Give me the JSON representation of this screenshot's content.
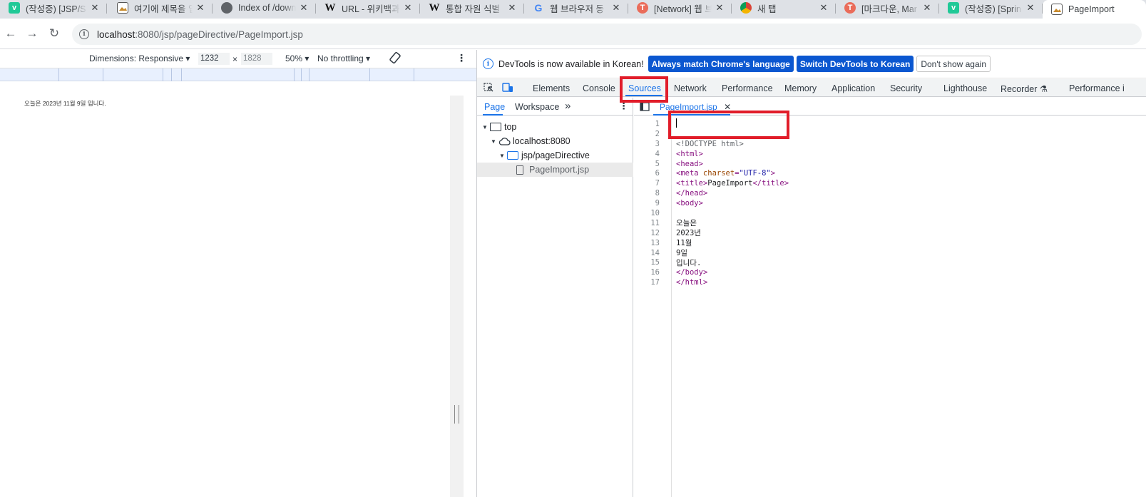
{
  "browser": {
    "tabs": [
      {
        "title": "(작성중) [JSP/S",
        "favicon": "v",
        "favicon_icon": "velog-icon",
        "active": false
      },
      {
        "title": "여기에 제목을 입",
        "favicon": "img",
        "favicon_icon": "image-icon",
        "active": false
      },
      {
        "title": "Index of /down",
        "favicon": "globe",
        "favicon_icon": "globe-icon",
        "active": false
      },
      {
        "title": "URL - 위키백과",
        "favicon": "W",
        "favicon_icon": "wikipedia-icon",
        "active": false
      },
      {
        "title": "통합 자원 식별",
        "favicon": "W",
        "favicon_icon": "wikipedia-icon",
        "active": false
      },
      {
        "title": "웹 브라우저 동",
        "favicon": "G",
        "favicon_icon": "google-icon",
        "active": false
      },
      {
        "title": "[Network] 웹 브",
        "favicon": "T",
        "favicon_icon": "tistory-icon",
        "active": false
      },
      {
        "title": "새 탭",
        "favicon": "chrome",
        "favicon_icon": "chrome-icon",
        "active": false
      },
      {
        "title": "[마크다운, Mar",
        "favicon": "T",
        "favicon_icon": "tistory-icon",
        "active": false
      },
      {
        "title": "(작성중) [Sprin",
        "favicon": "v",
        "favicon_icon": "velog-icon",
        "active": false
      },
      {
        "title": "PageImport",
        "favicon": "img",
        "favicon_icon": "image-icon",
        "active": true
      }
    ],
    "url_host": "localhost",
    "url_path": ":8080/jsp/pageDirective/PageImport.jsp"
  },
  "device_toolbar": {
    "dimensions": "Dimensions: Responsive",
    "width": "1232",
    "height": "1828",
    "times": "×",
    "zoom": "50%",
    "throttling": "No throttling"
  },
  "viewport": {
    "page_text": "오늘은 2023년 11월 9일 입니다."
  },
  "devtools": {
    "infobar": {
      "message": "DevTools is now available in Korean!",
      "btn_match": "Always match Chrome's language",
      "btn_switch": "Switch DevTools to Korean",
      "btn_dismiss": "Don't show again"
    },
    "tabs": [
      "Elements",
      "Console",
      "Sources",
      "Network",
      "Performance",
      "Memory",
      "Application",
      "Security",
      "Lighthouse",
      "Recorder",
      "Performance i"
    ],
    "active_tab": "Sources",
    "navigator": {
      "tabs": [
        "Page",
        "Workspace"
      ],
      "more": "»",
      "tree": [
        {
          "label": "top",
          "level": 0,
          "icon": "frame-icon"
        },
        {
          "label": "localhost:8080",
          "level": 1,
          "icon": "cloud-icon"
        },
        {
          "label": "jsp/pageDirective",
          "level": 2,
          "icon": "folder-icon"
        },
        {
          "label": "PageImport.jsp",
          "level": 3,
          "icon": "file-icon"
        }
      ]
    },
    "editor": {
      "file_tab": "PageImport.jsp",
      "lines": [
        "",
        "",
        "<!DOCTYPE html>",
        "<html>",
        "<head>",
        "<meta charset=\"UTF-8\">",
        "<title>PageImport</title>",
        "</head>",
        "<body>",
        "",
        "오늘은",
        "2023년",
        "11월",
        "9일",
        "입니다.",
        "</body>",
        "</html>"
      ]
    }
  },
  "colors": {
    "highlight": "#e11d2a",
    "accent": "#1a73e8",
    "button_blue": "#0b57d0"
  }
}
